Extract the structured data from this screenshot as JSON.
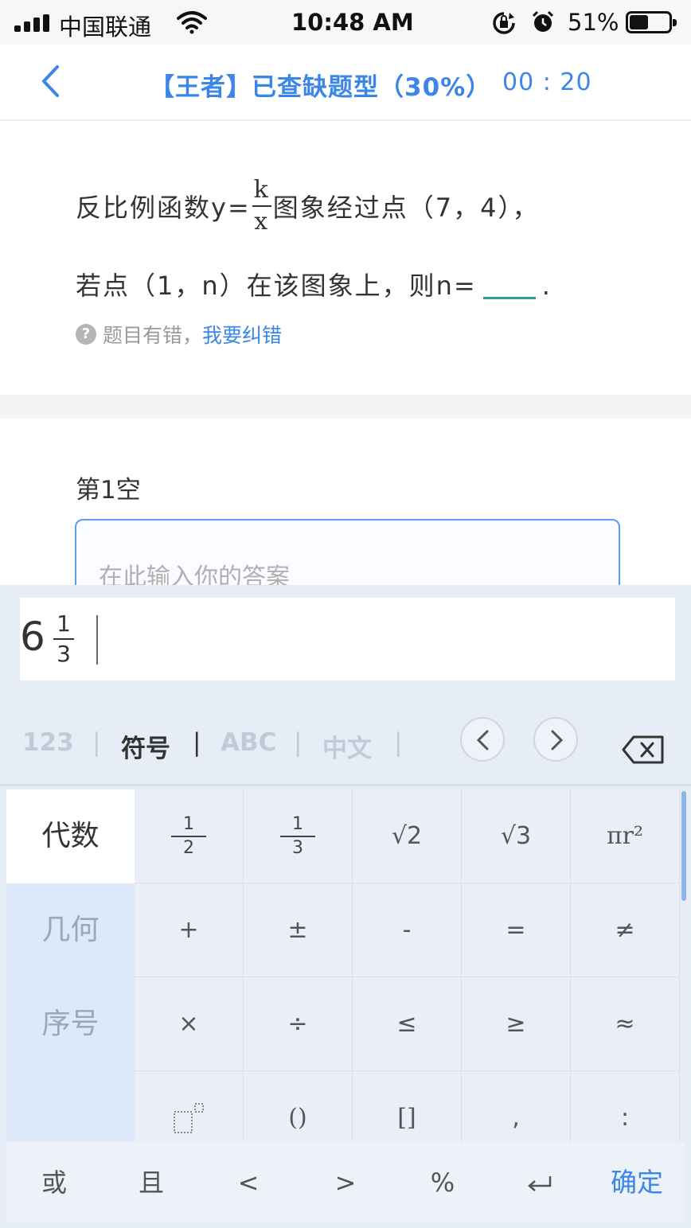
{
  "status_bar": {
    "carrier": "中国联通",
    "time": "10:48 AM",
    "battery_percent": "51%",
    "battery_level": 0.51,
    "icons": [
      "signal-icon",
      "wifi-icon",
      "rotation-lock-icon",
      "alarm-icon",
      "battery-icon"
    ]
  },
  "nav": {
    "back_icon": "chevron-left-icon",
    "title": "【王者】已查缺题型（30%）",
    "timer": "00 : 20",
    "accent_color": "#3b86e8"
  },
  "question": {
    "line1_prefix": "反比例函数y=",
    "frac_num": "k",
    "frac_den": "x",
    "line1_suffix": "图象经过点（7，4），",
    "line2_prefix": "若点（1，n）在该图象上，则n=",
    "line2_suffix": ".",
    "report_text": "题目有错，",
    "report_link": "我要纠错"
  },
  "answer": {
    "blank_label": "第1空",
    "placeholder": "在此输入你的答案"
  },
  "keyboard": {
    "preview": {
      "whole": "6",
      "num": "1",
      "den": "3"
    },
    "tabs": [
      "123",
      "符号",
      "ABC",
      "中文"
    ],
    "active_tab": "符号",
    "separator": "|",
    "prev_icon": "chevron-left-icon",
    "next_icon": "chevron-right-icon",
    "backspace_icon": "backspace-icon",
    "categories": [
      "代数",
      "几何",
      "序号"
    ],
    "active_category": "代数",
    "frac_half": {
      "num": "1",
      "den": "2"
    },
    "frac_third": {
      "num": "1",
      "den": "3"
    },
    "sqrt2": "√2",
    "sqrt3": "√3",
    "pi_r2": "πr²",
    "keys_row2": [
      "+",
      "±",
      "-",
      "=",
      "≠"
    ],
    "keys_row3": [
      "×",
      "÷",
      "≤",
      "≥",
      "≈"
    ],
    "keys_row4": [
      "superscript-icon",
      "()",
      "[]",
      ",",
      ":"
    ],
    "keys_row4_labels": [
      "",
      "()",
      "[]",
      ",",
      ":"
    ],
    "bottom": [
      "或",
      "且",
      "<",
      ">",
      "%",
      "enter-icon",
      "确定"
    ],
    "bottom_labels": [
      "或",
      "且",
      "<",
      ">",
      "%",
      "",
      "确定"
    ]
  }
}
